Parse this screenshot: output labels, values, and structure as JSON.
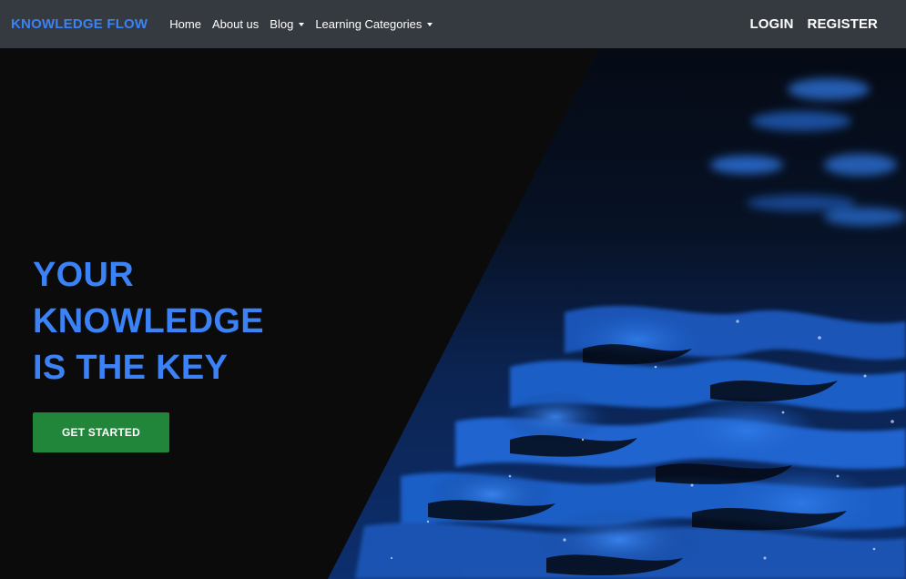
{
  "navbar": {
    "brand": "KNOWLEDGE FLOW",
    "links": [
      {
        "label": "Home"
      },
      {
        "label": "About us"
      },
      {
        "label": "Blog"
      },
      {
        "label": "Learning Categories"
      }
    ],
    "login_label": "LOGIN",
    "register_label": "REGISTER"
  },
  "hero": {
    "title_lines": [
      "YOUR",
      "KNOWLEDGE",
      "IS THE KEY"
    ],
    "cta_label": "GET STARTED"
  },
  "colors": {
    "navbar_bg": "#343a40",
    "brand": "#3b82f6",
    "hero_bg": "#0b0b0c",
    "title": "#3b82f6",
    "cta_bg": "#22863a",
    "water": "#1e62c8"
  },
  "icons": {
    "dropdown": "chevron-down-icon"
  }
}
